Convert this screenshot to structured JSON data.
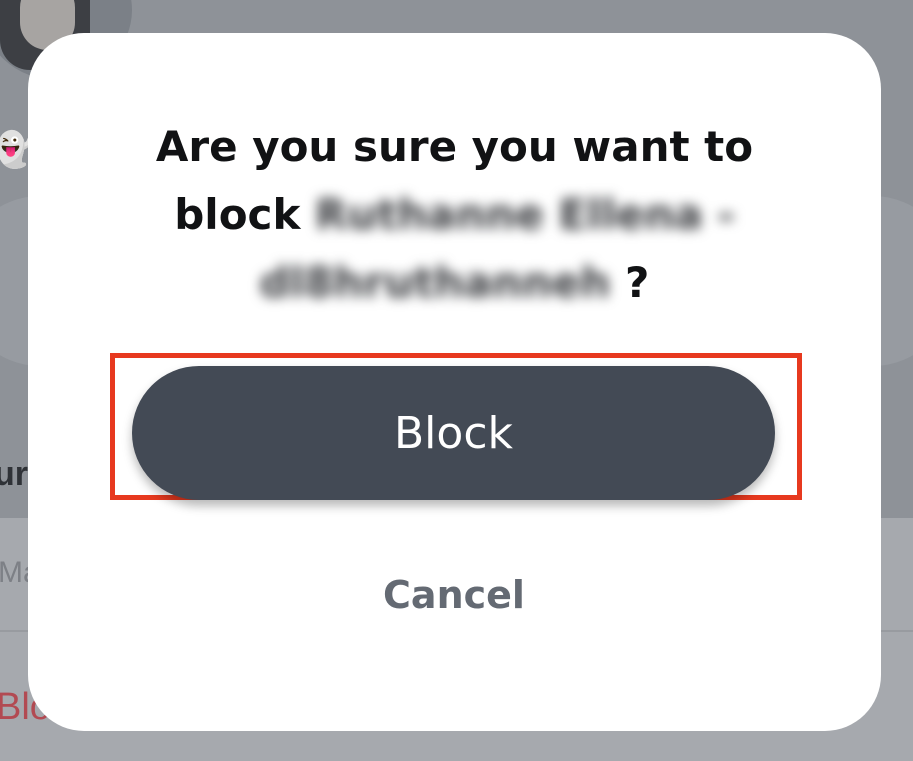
{
  "background": {
    "section_heading_fragment": "ur",
    "row_manage_fragment": "Ma",
    "row_block_fragment": "Blo",
    "ghost_icon": "snapchat-ghost-icon"
  },
  "dialog": {
    "question_prefix": "Are you sure you want to block",
    "blocked_user_display": "Ruthanne Ellena - dl8hruthanneh",
    "question_suffix": "?",
    "block_label": "Block",
    "cancel_label": "Cancel"
  },
  "colors": {
    "highlight": "#e7391f",
    "block_button": "#434a55",
    "cancel_text": "#646a73"
  }
}
